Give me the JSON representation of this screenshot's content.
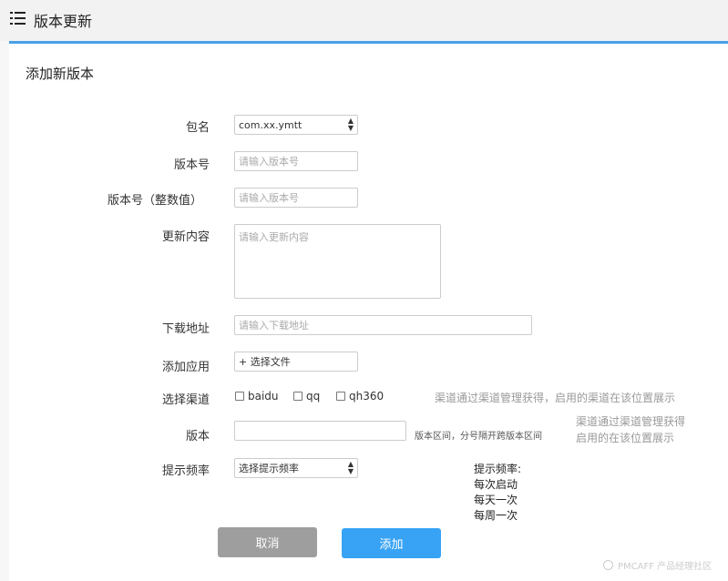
{
  "header": {
    "title": "版本更新",
    "menu_icon": "list-icon"
  },
  "section_title": "添加新版本",
  "form": {
    "package": {
      "label": "包名",
      "value": "com.xx.ymtt"
    },
    "version": {
      "label": "版本号",
      "placeholder": "请输入版本号"
    },
    "version_int": {
      "label": "版本号（整数值）",
      "placeholder": "请输入版本号"
    },
    "content": {
      "label": "更新内容",
      "placeholder": "请输入更新内容"
    },
    "download": {
      "label": "下载地址",
      "placeholder": "请输入下载地址"
    },
    "app": {
      "label": "添加应用",
      "button": "+ 选择文件"
    },
    "channel": {
      "label": "选择渠道",
      "options": [
        "baidu",
        "qq",
        "qh360"
      ],
      "hint": "渠道通过渠道管理获得，启用的渠道在该位置展示"
    },
    "range": {
      "label": "版本",
      "hint_small": "版本区间，分号隔开跨版本区间",
      "hint_line1": "渠道通过渠道管理获得",
      "hint_line2": "启用的在该位置展示"
    },
    "frequency": {
      "label": "提示频率",
      "value": "选择提示频率",
      "note_title": "提示频率:",
      "note_items": [
        "每次启动",
        "每天一次",
        "每周一次"
      ]
    }
  },
  "actions": {
    "cancel": "取消",
    "add": "添加"
  },
  "watermark": "PMCAFF 产品经理社区",
  "colors": {
    "accent": "#38a3f5",
    "topline": "#4a9fe8",
    "cancel": "#9e9e9e"
  }
}
